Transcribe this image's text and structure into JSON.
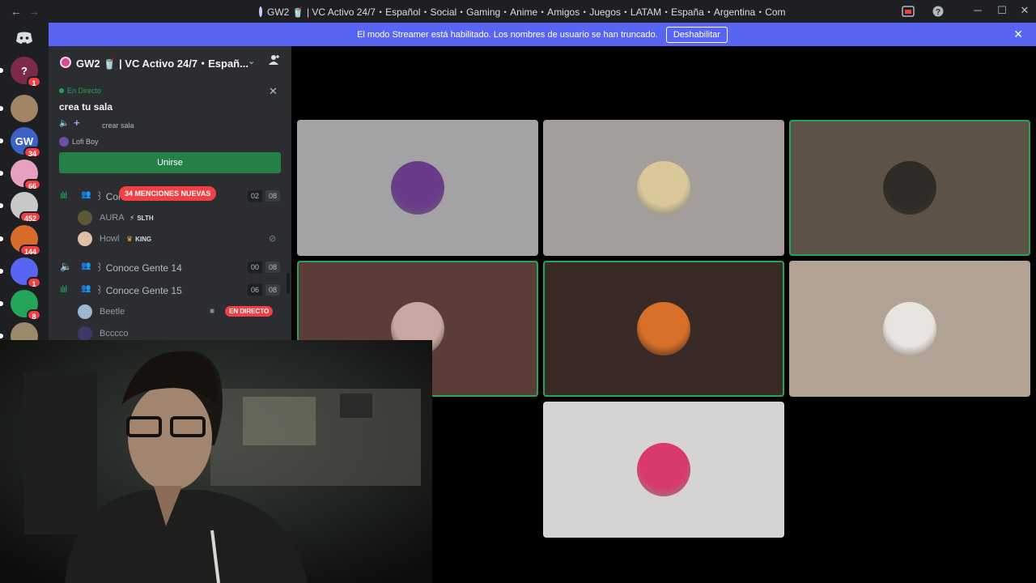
{
  "titlebar": {
    "title": "GW2 🥤 | VC Activo 24/7・Español・Social・Gaming・Anime・Amigos・Juegos・LATAM・España・Argentina・Comu...",
    "back": "←",
    "forward": "→",
    "minimize": "─",
    "maximize": "☐",
    "close": "✕"
  },
  "banner": {
    "message": "El modo Streamer está habilitado. Los nombres de usuario se han truncado.",
    "disable_label": "Deshabilitar",
    "close": "✕"
  },
  "servers": [
    {
      "name": "help-server",
      "badge": "1",
      "color": "#7c2a4a",
      "glyph": "?"
    },
    {
      "name": "cat-server",
      "badge": "",
      "color": "#a08664",
      "glyph": ""
    },
    {
      "name": "gw-server",
      "badge": "34",
      "color": "#3c62c8",
      "glyph": "GW"
    },
    {
      "name": "anime-server",
      "badge": "66",
      "color": "#e6a0c0",
      "glyph": ""
    },
    {
      "name": "manga-server",
      "badge": "452",
      "color": "#c8c8c8",
      "glyph": ""
    },
    {
      "name": "games-server",
      "badge": "144",
      "color": "#d86a2a",
      "glyph": ""
    },
    {
      "name": "discord-server",
      "badge": "1",
      "color": "#5865f2",
      "glyph": ""
    },
    {
      "name": "creeper-server",
      "badge": "8",
      "color": "#23a55a",
      "glyph": ""
    },
    {
      "name": "extra-server",
      "badge": "",
      "color": "#9a8a6a",
      "glyph": ""
    }
  ],
  "sidebar": {
    "server_name": "GW2 🥤 | VC Activo 24/7・Españ...",
    "live": {
      "status": "En Directo",
      "stage_name": "crea tu sala",
      "subtitle": "crear sala",
      "host": "Lofi Boy",
      "join_label": "Unirse"
    },
    "mentions": "34 MENCIONES NUEVAS",
    "channels": [
      {
        "name": "꒱ Conoce Gente 13",
        "count_a": "02",
        "count_b": "08"
      },
      {
        "name": "꒱ Conoce Gente 14",
        "count_a": "00",
        "count_b": "08"
      },
      {
        "name": "꒱ Conoce Gente 15",
        "count_a": "06",
        "count_b": "08"
      }
    ],
    "members": [
      {
        "name": "AURA",
        "tag": "SLTH"
      },
      {
        "name": "Howl",
        "tag": "KING"
      },
      {
        "name": "Beetle",
        "live": "EN DIRECTO"
      },
      {
        "name": "Bcccco"
      }
    ]
  },
  "tiles": [
    {
      "bg": "#a3a3a6",
      "avatar": "#6a3a8a",
      "speaking": false
    },
    {
      "bg": "#a49e9a",
      "avatar": "#d8c89a",
      "speaking": false
    },
    {
      "bg": "#5c5346",
      "avatar": "#2e2a26",
      "speaking": true
    },
    {
      "bg": "#5b3c38",
      "avatar": "#c8a8a0",
      "speaking": true
    },
    {
      "bg": "#3a2a26",
      "avatar": "#d8702a",
      "speaking": true
    },
    {
      "bg": "#b1a294",
      "avatar": "#e8e4e0",
      "speaking": false
    },
    {
      "bg": "#d6d4d3",
      "avatar": "#d83a6a",
      "speaking": false
    }
  ]
}
